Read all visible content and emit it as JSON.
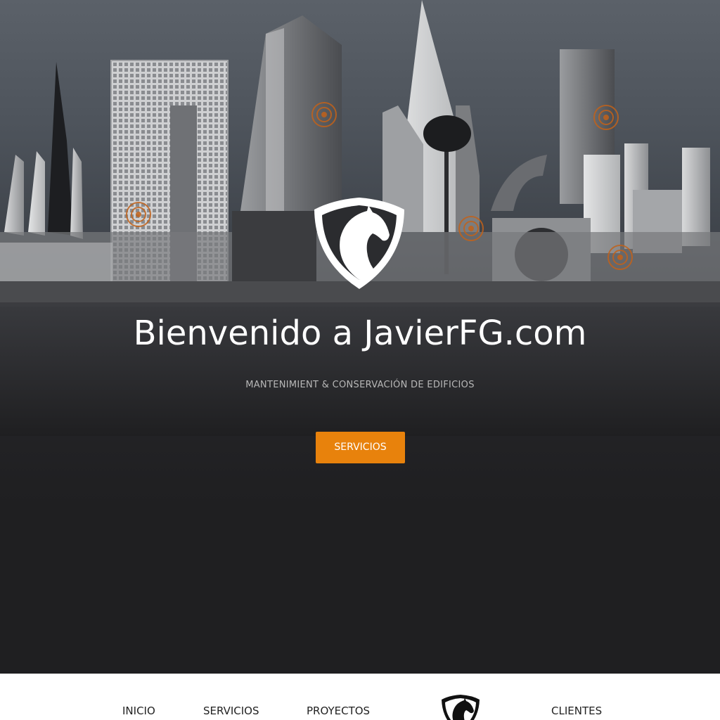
{
  "hero": {
    "title": "Bienvenido a JavierFG.com",
    "subtitle": "MANTENIMIENT & CONSERVACIÓN DE EDIFICIOS",
    "cta_label": "SERVICIOS",
    "accent_color": "#e8820c",
    "background_image": "city-skyline-icon",
    "logo_icon": "horse-shield-logo-icon"
  },
  "nav": {
    "items": [
      {
        "label": "INICIO"
      },
      {
        "label": "SERVICIOS"
      },
      {
        "label": "PROYECTOS"
      },
      {
        "label": "CLIENTES"
      }
    ],
    "logo_icon": "horse-shield-logo-icon"
  }
}
